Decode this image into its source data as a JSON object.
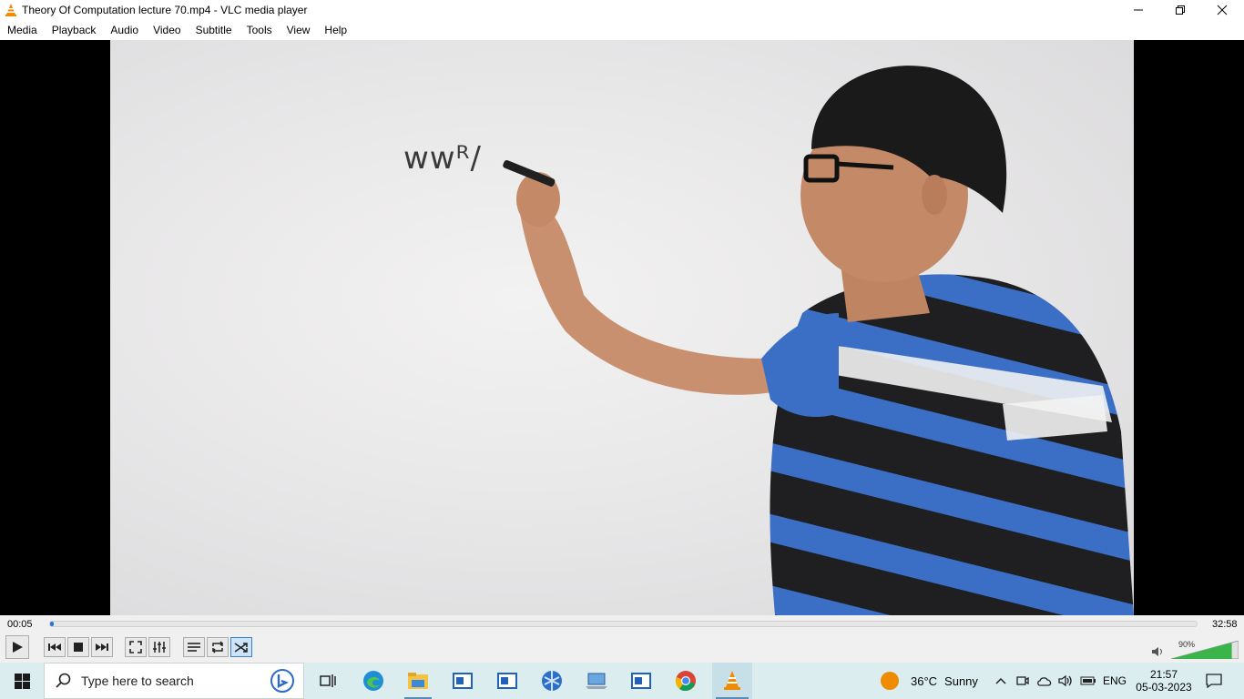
{
  "window": {
    "title": "Theory Of Computation lecture 70.mp4 - VLC media player"
  },
  "menu": [
    "Media",
    "Playback",
    "Audio",
    "Video",
    "Subtitle",
    "Tools",
    "View",
    "Help"
  ],
  "player": {
    "elapsed": "00:05",
    "duration": "32:58",
    "progress_fraction": 0.003,
    "volume_label": "90%",
    "volume_fraction": 0.9,
    "icons": [
      "play-icon",
      "previous-icon",
      "stop-icon",
      "next-icon",
      "fullscreen-icon",
      "extended-settings-icon",
      "playlist-icon",
      "loop-icon",
      "random-icon"
    ],
    "random_enabled": true
  },
  "video": {
    "board_text": "wwᴿ/"
  },
  "taskbar": {
    "search_placeholder": "Type here to search",
    "weather_temp": "36°C",
    "weather_desc": "Sunny",
    "language": "ENG",
    "time": "21:57",
    "date": "05-03-2023"
  },
  "colors": {
    "accent": "#2b74d6",
    "taskbar": "#dcedf0",
    "vlc_orange": "#f08a00"
  }
}
